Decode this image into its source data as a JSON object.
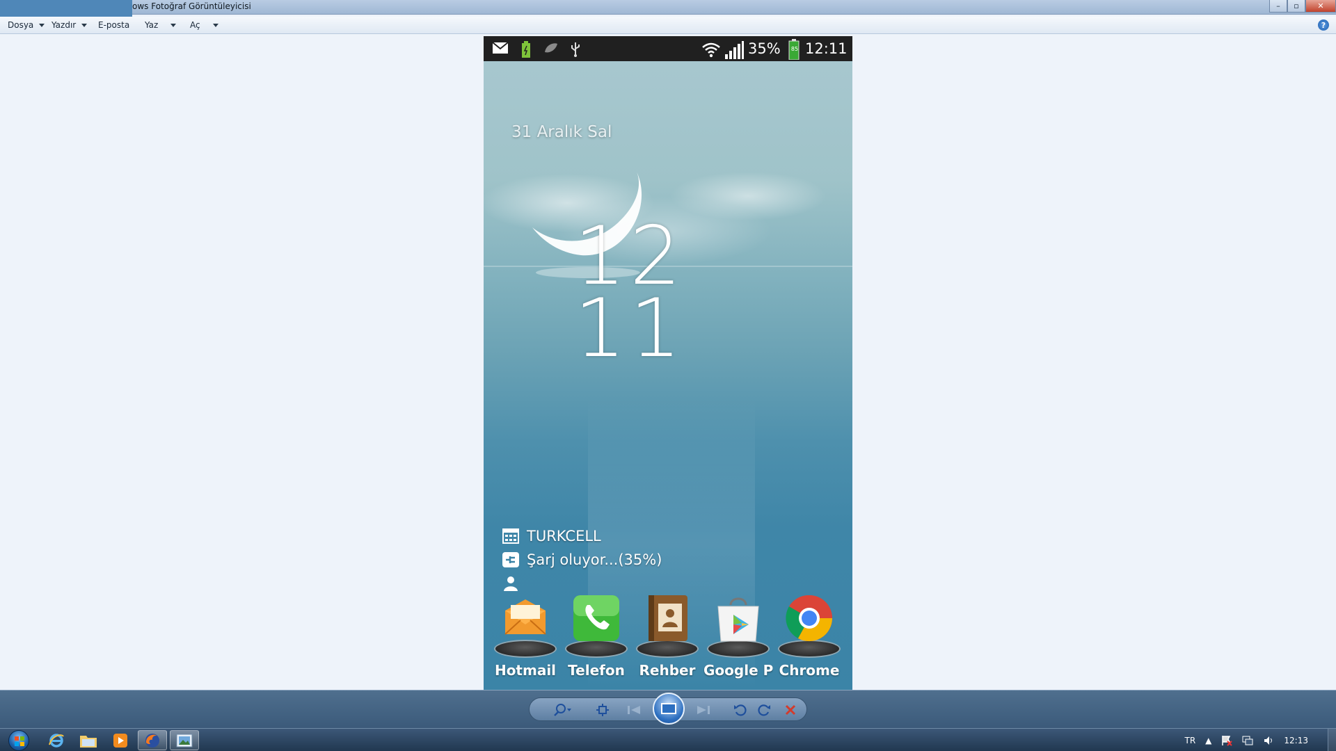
{
  "window": {
    "title": "ows Fotoğraf Görüntüleyicisi",
    "controls": {
      "minimize": "–",
      "maximize": "▫",
      "close": "✕"
    }
  },
  "menu": {
    "items": [
      {
        "label": "Dosya",
        "has_dropdown": true
      },
      {
        "label": "Yazdır",
        "has_dropdown": true
      },
      {
        "label": "E-posta",
        "has_dropdown": false
      },
      {
        "label": "Yaz",
        "has_dropdown": true
      },
      {
        "label": "Aç",
        "has_dropdown": true
      }
    ],
    "help_label": "?"
  },
  "phone": {
    "status_bar": {
      "battery_percent": "35%",
      "battery_level_label": "85",
      "time": "12:11",
      "icons": [
        "gmail-icon",
        "battery-charging-icon",
        "leaf-icon",
        "usb-icon",
        "wifi-icon",
        "signal-icon"
      ]
    },
    "lockscreen": {
      "date": "31 Aralık Sal",
      "clock_hour": "12",
      "clock_minute": "11",
      "info": [
        {
          "icon": "calendar-grid-icon",
          "text": "TURKCELL"
        },
        {
          "icon": "charging-plug-icon",
          "text": "Şarj oluyor...(35%)"
        },
        {
          "icon": "owner-person-icon",
          "text": ""
        }
      ]
    },
    "dock": [
      {
        "label": "Hotmail",
        "icon": "hotmail-icon",
        "color": "#f29a2e"
      },
      {
        "label": "Telefon",
        "icon": "phone-icon",
        "color": "#3fb93a"
      },
      {
        "label": "Rehber",
        "icon": "contacts-icon",
        "color": "#8a5a2b"
      },
      {
        "label": "Google P",
        "icon": "play-store-icon",
        "color": "#ffffff"
      },
      {
        "label": "Chrome",
        "icon": "chrome-icon",
        "color": "#db4437"
      }
    ]
  },
  "taskbar": {
    "language": "TR",
    "time": "12:13",
    "apps": [
      "internet-explorer-icon",
      "file-explorer-icon",
      "media-player-icon",
      "firefox-icon",
      "photo-viewer-icon"
    ]
  }
}
